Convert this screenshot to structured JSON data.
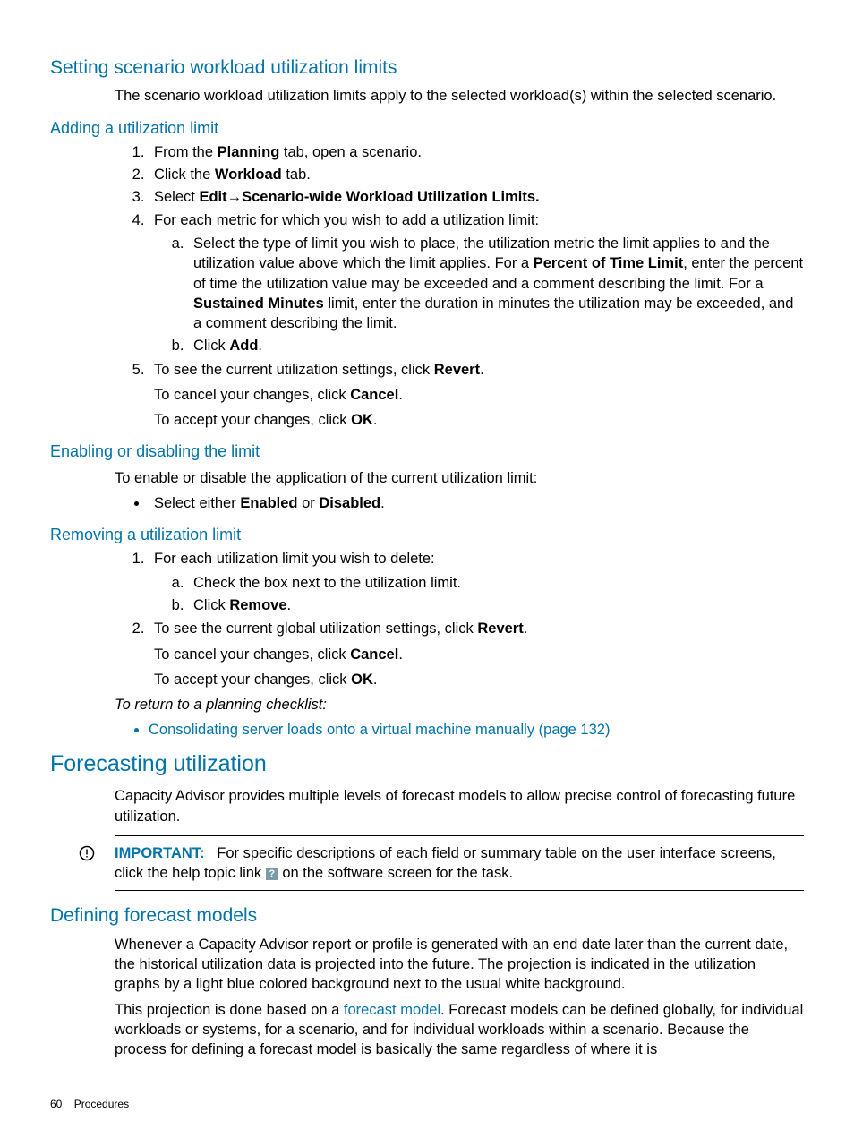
{
  "h_setting": "Setting scenario workload utilization limits",
  "p_setting_intro": "The scenario workload utilization limits apply to the selected workload(s) within the selected scenario.",
  "h_adding": "Adding a utilization limit",
  "add_1_a": "From the ",
  "add_1_b": "Planning",
  "add_1_c": " tab, open a scenario.",
  "add_2_a": "Click the ",
  "add_2_b": "Workload",
  "add_2_c": " tab.",
  "add_3_a": "Select ",
  "add_3_b": "Edit",
  "add_3_arrow": "→",
  "add_3_c": "Scenario-wide Workload Utilization Limits.",
  "add_4": "For each metric for which you wish to add a utilization limit:",
  "add_4a_1": "Select the type of limit you wish to place, the utilization metric the limit applies to and the utilization value above which the limit applies. For a ",
  "add_4a_b1": "Percent of Time Limit",
  "add_4a_2": ", enter the percent of time the utilization value may be exceeded and a comment describing the limit. For a ",
  "add_4a_b2": "Sustained Minutes",
  "add_4a_3": " limit, enter the duration in minutes the utilization may be exceeded, and a comment describing the limit.",
  "add_4b_a": "Click ",
  "add_4b_b": "Add",
  "add_4b_c": ".",
  "add_5_a": "To see the current utilization settings, click ",
  "add_5_b": "Revert",
  "add_5_c": ".",
  "add_5_p1_a": "To cancel your changes, click ",
  "add_5_p1_b": "Cancel",
  "add_5_p1_c": ".",
  "add_5_p2_a": "To accept your changes, click ",
  "add_5_p2_b": "OK",
  "add_5_p2_c": ".",
  "h_enabling": "Enabling or disabling the limit",
  "p_enabling": "To enable or disable the application of the current utilization limit:",
  "en_bullet_a": "Select either ",
  "en_bullet_b": "Enabled",
  "en_bullet_mid": " or ",
  "en_bullet_c": "Disabled",
  "en_bullet_d": ".",
  "h_removing": "Removing a utilization limit",
  "rem_1": "For each utilization limit you wish to delete:",
  "rem_1a": "Check the box next to the utilization limit.",
  "rem_1b_a": "Click ",
  "rem_1b_b": "Remove",
  "rem_1b_c": ".",
  "rem_2_a": "To see the current global utilization settings, click ",
  "rem_2_b": "Revert",
  "rem_2_c": ".",
  "rem_2_p1_a": "To cancel your changes, click ",
  "rem_2_p1_b": "Cancel",
  "rem_2_p1_c": ".",
  "rem_2_p2_a": "To accept your changes, click ",
  "rem_2_p2_b": "OK",
  "rem_2_p2_c": ".",
  "p_return": "To return to a planning checklist:",
  "link_consolidate": "Consolidating server loads onto a virtual machine manually (page 132)",
  "h_forecasting": "Forecasting utilization",
  "p_forecasting": "Capacity Advisor provides multiple levels of forecast models to allow precise control of forecasting future utilization.",
  "important_label": "IMPORTANT:",
  "important_1": "For specific descriptions of each field or summary table on the user interface screens, click the help topic link ",
  "important_2": " on the software screen for the task.",
  "h_defining": "Defining forecast models",
  "p_def1": "Whenever a Capacity Advisor report or profile is generated with an end date later than the current date, the historical utilization data is projected into the future. The projection is indicated in the utilization graphs by a light blue colored background next to the usual white background.",
  "p_def2_a": "This projection is done based on a ",
  "p_def2_link": "forecast model",
  "p_def2_b": ". Forecast models can be defined globally, for individual workloads or systems, for a scenario, and for individual workloads within a scenario. Because the process for defining a forecast model is basically the same regardless of where it is",
  "footer_page": "60",
  "footer_label": "Procedures"
}
